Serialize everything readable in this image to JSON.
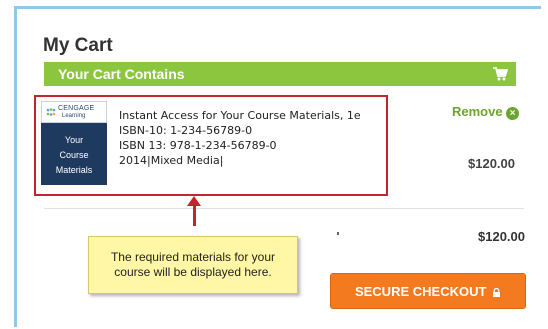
{
  "cart": {
    "title": "My Cart",
    "header": "Your Cart Contains",
    "item": {
      "publisher_line1": "CENGAGE",
      "publisher_line2": "Learning",
      "thumb_line1": "Your",
      "thumb_line2": "Course",
      "thumb_line3": "Materials",
      "name": "Instant Access for Your Course Materials, 1e",
      "isbn10": "ISBN-10: 1-234-56789-0",
      "isbn13": "ISBN 13: 978-1-234-56789-0",
      "meta": "2014|Mixed Media|",
      "remove_label": "Remove",
      "price": "$120.00"
    },
    "total": "$120.00",
    "checkout_label": "SECURE CHECKOUT"
  },
  "callout": {
    "line1": "The required materials for your",
    "line2": "course will be displayed here."
  },
  "colors": {
    "header_green": "#8cc63f",
    "highlight_red": "#c0272d",
    "checkout_orange": "#f47a20",
    "callout_yellow": "#fff7a6",
    "frame_blue": "#8fc8ea"
  }
}
